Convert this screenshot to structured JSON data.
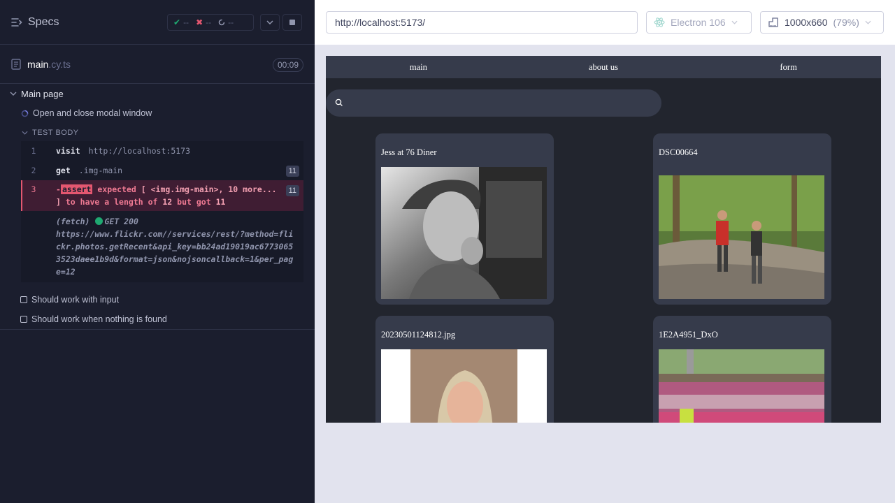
{
  "reporter": {
    "header": {
      "specs_label": "Specs",
      "passed": "--",
      "failed": "--",
      "pending": "--"
    },
    "file": {
      "name": "main",
      "ext": ".cy.ts",
      "duration": "00:09"
    },
    "suite": {
      "title": "Main page",
      "active_test": "Open and close modal window",
      "body_label": "TEST BODY",
      "commands": [
        {
          "num": "1",
          "name": "visit",
          "message": "http://localhost:5173"
        },
        {
          "num": "2",
          "name": "get",
          "message": ".img-main",
          "count": "11"
        }
      ],
      "failed_command": {
        "num": "3",
        "prefix": "-",
        "name": "assert",
        "expected_word": "expected",
        "subject": "[ <img.img-main>, 10 more... ]",
        "to_have": "to have a length of",
        "expected_value": "12",
        "but_got": "but got",
        "actual_value": "11",
        "count": "11"
      },
      "fetch": {
        "label": "(fetch)",
        "status": "GET 200",
        "url": "https://www.flickr.com//services/rest/?method=flickr.photos.getRecent&api_key=bb24ad19019ac67730653523daee1b9d&format=json&nojsoncallback=1&per_page=12"
      },
      "pending_tests": [
        "Should work with input",
        "Should work when nothing is found"
      ]
    }
  },
  "browser": {
    "url": "http://localhost:5173/",
    "browser_name": "Electron 106",
    "viewport": "1000x660",
    "zoom": "(79%)"
  },
  "aut": {
    "nav": [
      "main",
      "about us",
      "form"
    ],
    "cards": [
      {
        "title": "Jess at 76 Diner"
      },
      {
        "title": "DSC00664"
      },
      {
        "title": "20230501124812.jpg"
      },
      {
        "title": "1E2A4951_DxO"
      }
    ]
  },
  "colors": {
    "reporter_bg": "#1b1e2e",
    "pass": "#1fa971",
    "fail": "#e45770",
    "app_bg": "#22252e",
    "card_bg": "#363b4b"
  }
}
